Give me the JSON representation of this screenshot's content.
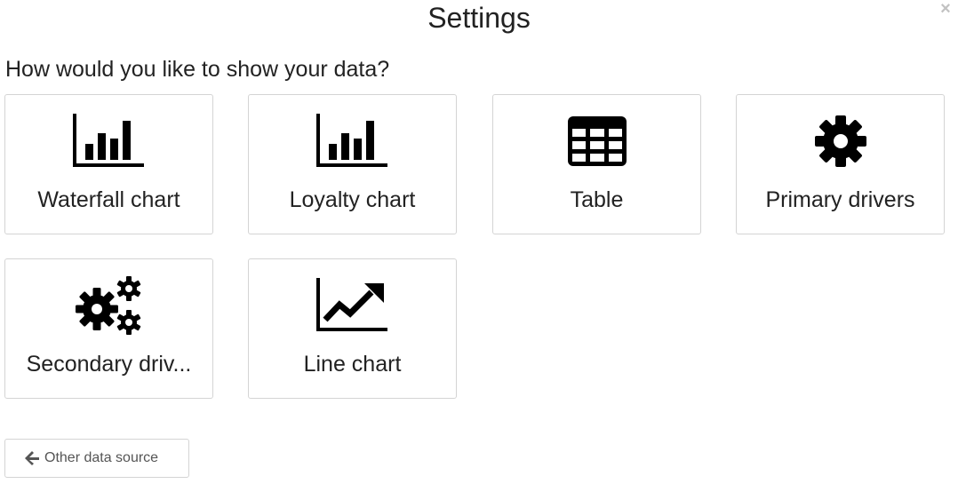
{
  "dialog": {
    "title": "Settings",
    "close_glyph": "×"
  },
  "prompt": "How would you like to show your data?",
  "options": [
    {
      "label": "Waterfall chart",
      "icon": "bar-chart-icon"
    },
    {
      "label": "Loyalty chart",
      "icon": "bar-chart-icon"
    },
    {
      "label": "Table",
      "icon": "table-icon"
    },
    {
      "label": "Primary drivers",
      "icon": "gear-icon"
    },
    {
      "label": "Secondary driv...",
      "icon": "gears-icon"
    },
    {
      "label": "Line chart",
      "icon": "line-chart-icon"
    }
  ],
  "footer": {
    "back_label": "Other data source",
    "back_icon": "arrow-left-icon"
  }
}
